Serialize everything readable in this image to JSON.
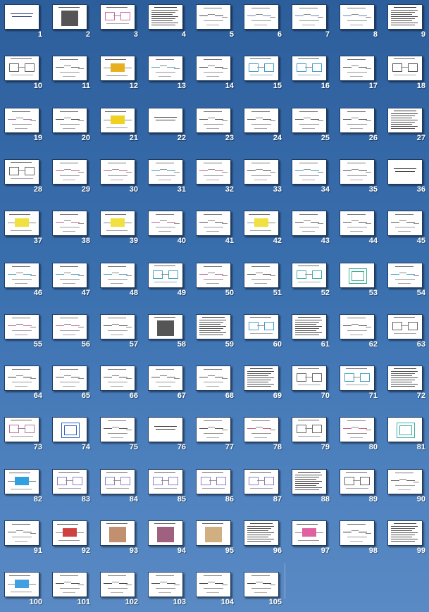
{
  "slide_sorter": {
    "slides": [
      {
        "number": "1",
        "kind": "title",
        "accent": "#3b4a8a"
      },
      {
        "number": "2",
        "kind": "photo",
        "accent": "#555555"
      },
      {
        "number": "3",
        "kind": "diagram",
        "accent": "#d06aa0"
      },
      {
        "number": "4",
        "kind": "text",
        "accent": "#333333"
      },
      {
        "number": "5",
        "kind": "structure",
        "accent": "#444444"
      },
      {
        "number": "6",
        "kind": "structure",
        "accent": "#6a8ab0"
      },
      {
        "number": "7",
        "kind": "structure",
        "accent": "#6a8ab0"
      },
      {
        "number": "8",
        "kind": "structure",
        "accent": "#6a8ab0"
      },
      {
        "number": "9",
        "kind": "text",
        "accent": "#333333"
      },
      {
        "number": "10",
        "kind": "diagram",
        "accent": "#666666"
      },
      {
        "number": "11",
        "kind": "structure",
        "accent": "#555555"
      },
      {
        "number": "12",
        "kind": "colored",
        "accent": "#e8b020"
      },
      {
        "number": "13",
        "kind": "structure",
        "accent": "#5aa0c0"
      },
      {
        "number": "14",
        "kind": "structure",
        "accent": "#444444"
      },
      {
        "number": "15",
        "kind": "diagram",
        "accent": "#40a0d0"
      },
      {
        "number": "16",
        "kind": "diagram",
        "accent": "#40a0d0"
      },
      {
        "number": "17",
        "kind": "structure",
        "accent": "#555555"
      },
      {
        "number": "18",
        "kind": "diagram",
        "accent": "#555555"
      },
      {
        "number": "19",
        "kind": "structure",
        "accent": "#9a6ab0"
      },
      {
        "number": "20",
        "kind": "structure",
        "accent": "#444444"
      },
      {
        "number": "21",
        "kind": "colored",
        "accent": "#f0d020"
      },
      {
        "number": "22",
        "kind": "title",
        "accent": "#444444"
      },
      {
        "number": "23",
        "kind": "structure",
        "accent": "#555555"
      },
      {
        "number": "24",
        "kind": "structure",
        "accent": "#555555"
      },
      {
        "number": "25",
        "kind": "structure",
        "accent": "#555555"
      },
      {
        "number": "26",
        "kind": "structure",
        "accent": "#555555"
      },
      {
        "number": "27",
        "kind": "text",
        "accent": "#333333"
      },
      {
        "number": "28",
        "kind": "diagram",
        "accent": "#666666"
      },
      {
        "number": "29",
        "kind": "structure",
        "accent": "#c060a0"
      },
      {
        "number": "30",
        "kind": "structure",
        "accent": "#c060a0"
      },
      {
        "number": "31",
        "kind": "structure",
        "accent": "#40a0c0"
      },
      {
        "number": "32",
        "kind": "structure",
        "accent": "#c060a0"
      },
      {
        "number": "33",
        "kind": "structure",
        "accent": "#555555"
      },
      {
        "number": "34",
        "kind": "structure",
        "accent": "#40a0c0"
      },
      {
        "number": "35",
        "kind": "structure",
        "accent": "#555555"
      },
      {
        "number": "36",
        "kind": "title",
        "accent": "#444444"
      },
      {
        "number": "37",
        "kind": "colored",
        "accent": "#f0e040"
      },
      {
        "number": "38",
        "kind": "structure",
        "accent": "#c060a0"
      },
      {
        "number": "39",
        "kind": "colored",
        "accent": "#f0e040"
      },
      {
        "number": "40",
        "kind": "structure",
        "accent": "#c060a0"
      },
      {
        "number": "41",
        "kind": "structure",
        "accent": "#555555"
      },
      {
        "number": "42",
        "kind": "colored",
        "accent": "#f0e040"
      },
      {
        "number": "43",
        "kind": "structure",
        "accent": "#555555"
      },
      {
        "number": "44",
        "kind": "structure",
        "accent": "#555555"
      },
      {
        "number": "45",
        "kind": "structure",
        "accent": "#555555"
      },
      {
        "number": "46",
        "kind": "structure",
        "accent": "#40a0c0"
      },
      {
        "number": "47",
        "kind": "structure",
        "accent": "#40a0c0"
      },
      {
        "number": "48",
        "kind": "structure",
        "accent": "#40a0c0"
      },
      {
        "number": "49",
        "kind": "diagram",
        "accent": "#40a0c0"
      },
      {
        "number": "50",
        "kind": "structure",
        "accent": "#c060a0"
      },
      {
        "number": "51",
        "kind": "structure",
        "accent": "#555555"
      },
      {
        "number": "52",
        "kind": "diagram",
        "accent": "#40b0a0"
      },
      {
        "number": "53",
        "kind": "ring",
        "accent": "#40b090"
      },
      {
        "number": "54",
        "kind": "structure",
        "accent": "#40a0c0"
      },
      {
        "number": "55",
        "kind": "structure",
        "accent": "#c060a0"
      },
      {
        "number": "56",
        "kind": "structure",
        "accent": "#c060a0"
      },
      {
        "number": "57",
        "kind": "structure",
        "accent": "#555555"
      },
      {
        "number": "58",
        "kind": "photo",
        "accent": "#555555"
      },
      {
        "number": "59",
        "kind": "text",
        "accent": "#333333"
      },
      {
        "number": "60",
        "kind": "diagram",
        "accent": "#40a0d0"
      },
      {
        "number": "61",
        "kind": "text",
        "accent": "#333333"
      },
      {
        "number": "62",
        "kind": "structure",
        "accent": "#555555"
      },
      {
        "number": "63",
        "kind": "diagram",
        "accent": "#666666"
      },
      {
        "number": "64",
        "kind": "structure",
        "accent": "#444444"
      },
      {
        "number": "65",
        "kind": "structure",
        "accent": "#555555"
      },
      {
        "number": "66",
        "kind": "structure",
        "accent": "#555555"
      },
      {
        "number": "67",
        "kind": "structure",
        "accent": "#555555"
      },
      {
        "number": "68",
        "kind": "structure",
        "accent": "#555555"
      },
      {
        "number": "69",
        "kind": "text",
        "accent": "#333333"
      },
      {
        "number": "70",
        "kind": "diagram",
        "accent": "#666666"
      },
      {
        "number": "71",
        "kind": "diagram",
        "accent": "#40a0c0"
      },
      {
        "number": "72",
        "kind": "text",
        "accent": "#333333"
      },
      {
        "number": "73",
        "kind": "diagram",
        "accent": "#c070a0"
      },
      {
        "number": "74",
        "kind": "ring",
        "accent": "#3060c0"
      },
      {
        "number": "75",
        "kind": "structure",
        "accent": "#555555"
      },
      {
        "number": "76",
        "kind": "title",
        "accent": "#444444"
      },
      {
        "number": "77",
        "kind": "structure",
        "accent": "#555555"
      },
      {
        "number": "78",
        "kind": "structure",
        "accent": "#c06080"
      },
      {
        "number": "79",
        "kind": "diagram",
        "accent": "#666666"
      },
      {
        "number": "80",
        "kind": "structure",
        "accent": "#c06080"
      },
      {
        "number": "81",
        "kind": "ring",
        "accent": "#40b0a0"
      },
      {
        "number": "82",
        "kind": "colored",
        "accent": "#30a0e0"
      },
      {
        "number": "83",
        "kind": "diagram",
        "accent": "#8a80c0"
      },
      {
        "number": "84",
        "kind": "diagram",
        "accent": "#8a80c0"
      },
      {
        "number": "85",
        "kind": "diagram",
        "accent": "#8a80c0"
      },
      {
        "number": "86",
        "kind": "diagram",
        "accent": "#8a80c0"
      },
      {
        "number": "87",
        "kind": "diagram",
        "accent": "#8a80c0"
      },
      {
        "number": "88",
        "kind": "text",
        "accent": "#333333"
      },
      {
        "number": "89",
        "kind": "diagram",
        "accent": "#666666"
      },
      {
        "number": "90",
        "kind": "structure",
        "accent": "#555555"
      },
      {
        "number": "91",
        "kind": "structure",
        "accent": "#555555"
      },
      {
        "number": "92",
        "kind": "colored",
        "accent": "#d04040"
      },
      {
        "number": "93",
        "kind": "photo",
        "accent": "#c09070"
      },
      {
        "number": "94",
        "kind": "photo",
        "accent": "#a06080"
      },
      {
        "number": "95",
        "kind": "photo",
        "accent": "#d0b080"
      },
      {
        "number": "96",
        "kind": "text",
        "accent": "#333333"
      },
      {
        "number": "97",
        "kind": "colored",
        "accent": "#e060a0"
      },
      {
        "number": "98",
        "kind": "structure",
        "accent": "#333333"
      },
      {
        "number": "99",
        "kind": "text",
        "accent": "#333333"
      },
      {
        "number": "100",
        "kind": "colored",
        "accent": "#40a0e0"
      },
      {
        "number": "101",
        "kind": "structure",
        "accent": "#555555"
      },
      {
        "number": "102",
        "kind": "structure",
        "accent": "#444444"
      },
      {
        "number": "103",
        "kind": "structure",
        "accent": "#555555"
      },
      {
        "number": "104",
        "kind": "structure",
        "accent": "#444444"
      },
      {
        "number": "105",
        "kind": "structure",
        "accent": "#444444"
      }
    ]
  }
}
